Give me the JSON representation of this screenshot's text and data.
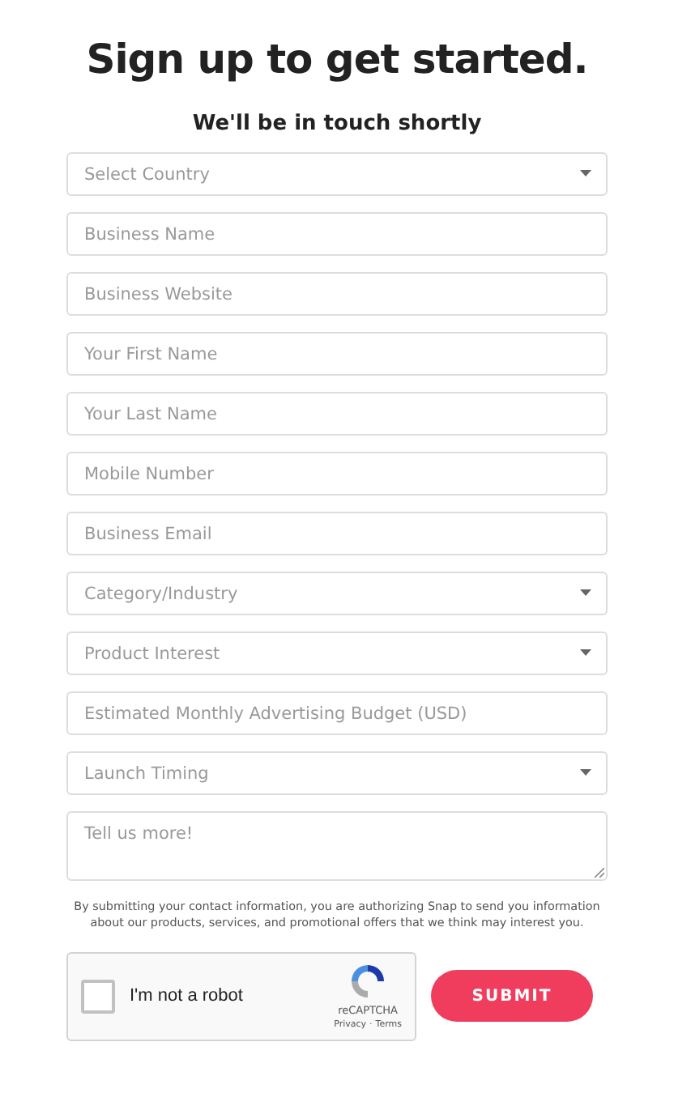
{
  "title": "Sign up to get started.",
  "subtitle": "We'll be in touch shortly",
  "fields": [
    {
      "kind": "select",
      "placeholder": "Select Country"
    },
    {
      "kind": "text",
      "placeholder": "Business Name"
    },
    {
      "kind": "text",
      "placeholder": "Business Website"
    },
    {
      "kind": "text",
      "placeholder": "Your First Name"
    },
    {
      "kind": "text",
      "placeholder": "Your Last Name"
    },
    {
      "kind": "text",
      "placeholder": "Mobile Number"
    },
    {
      "kind": "text",
      "placeholder": "Business Email"
    },
    {
      "kind": "select",
      "placeholder": "Category/Industry"
    },
    {
      "kind": "select",
      "placeholder": "Product Interest"
    },
    {
      "kind": "text",
      "placeholder": "Estimated Monthly Advertising Budget (USD)"
    },
    {
      "kind": "select",
      "placeholder": "Launch Timing"
    },
    {
      "kind": "textarea",
      "placeholder": "Tell us more!"
    }
  ],
  "disclaimer": "By submitting your contact information, you are authorizing Snap to send you information about our products, services, and promotional offers that we think may interest you.",
  "captcha": {
    "label": "I'm not a robot",
    "checked": false,
    "brand": "reCAPTCHA",
    "privacy": "Privacy",
    "separator": "·",
    "terms": "Terms"
  },
  "submit": "SUBMIT"
}
